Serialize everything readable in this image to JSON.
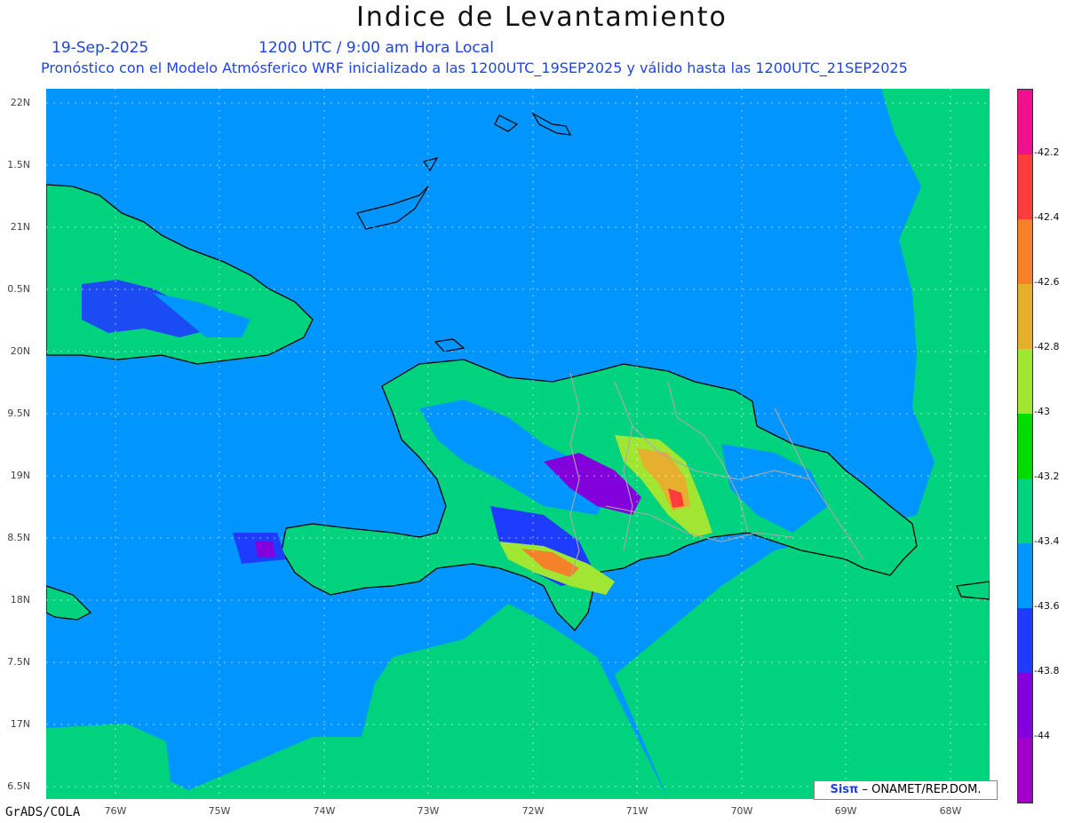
{
  "header": {
    "title": "Indice de Levantamiento",
    "date": "19-Sep-2025",
    "time": "1200 UTC / 9:00 am Hora Local",
    "subtitle": "Pronóstico con el Modelo Atmósferico WRF inicializado a las 1200UTC_19SEP2025 y válido hasta las  1200UTC_21SEP2025"
  },
  "map": {
    "lat_ticks": [
      "22N",
      "1.5N",
      "21N",
      "0.5N",
      "20N",
      "9.5N",
      "19N",
      "8.5N",
      "18N",
      "7.5N",
      "17N",
      "6.5N"
    ],
    "lon_ticks": [
      "76W",
      "75W",
      "74W",
      "73W",
      "72W",
      "71W",
      "70W",
      "69W",
      "68W"
    ],
    "background_color": "#0095ff",
    "ocean_east_color": "#00d080"
  },
  "colorbar": {
    "labels": [
      "-42.2",
      "-42.4",
      "-42.6",
      "-42.8",
      "-43",
      "-43.2",
      "-43.4",
      "-43.6",
      "-43.8",
      "-44"
    ],
    "colors": [
      "#f0108c",
      "#ff3c3c",
      "#f58228",
      "#e6af2d",
      "#a0e632",
      "#00dc00",
      "#00d27d",
      "#0096ff",
      "#1e3cff",
      "#8200dc",
      "#a000c8"
    ]
  },
  "footer": {
    "software": "GrADS/COLA",
    "credit_brand": "Sisπ",
    "credit_text": "– ONAMET/REP.DOM."
  }
}
